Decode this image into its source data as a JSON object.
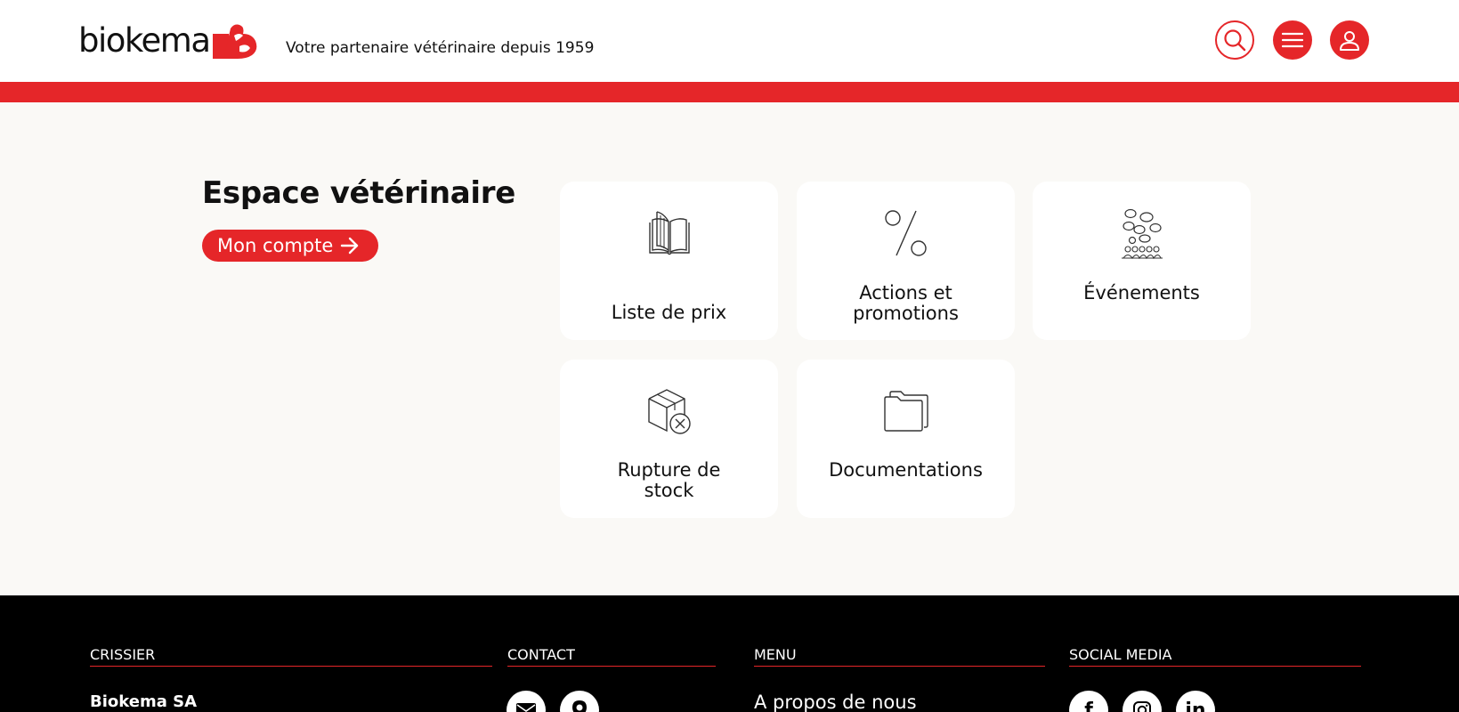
{
  "header": {
    "logo_text": "biokema",
    "tagline": "Votre partenaire vétérinaire depuis 1959",
    "icons": [
      "search-icon",
      "menu-icon",
      "user-icon"
    ]
  },
  "main": {
    "title": "Espace vétérinaire",
    "cta_label": "Mon compte",
    "tiles": [
      {
        "label_line1": "Liste de prix",
        "label_line2": "",
        "icon": "book-icon"
      },
      {
        "label_line1": "Actions et",
        "label_line2": "promotions",
        "icon": "percent-icon"
      },
      {
        "label_line1": "Événements",
        "label_line2": "",
        "icon": "people-icon"
      },
      {
        "label_line1": "Rupture de",
        "label_line2": "stock",
        "icon": "box-x-icon"
      },
      {
        "label_line1": "Documentations",
        "label_line2": "",
        "icon": "folder-icon"
      }
    ]
  },
  "footer": {
    "col1_heading": "CRISSIER",
    "col2_heading": "CONTACT",
    "col3_heading": "MENU",
    "col4_heading": "SOCIAL MEDIA",
    "company": "Biokema SA",
    "menu_first": "A propos de nous",
    "social": {
      "facebook": "f",
      "instagram": "instagram-icon",
      "linkedin": "in"
    }
  },
  "colors": {
    "brand_red": "#e52629",
    "footer_bg": "#000000",
    "page_bg": "#faf9f6"
  }
}
